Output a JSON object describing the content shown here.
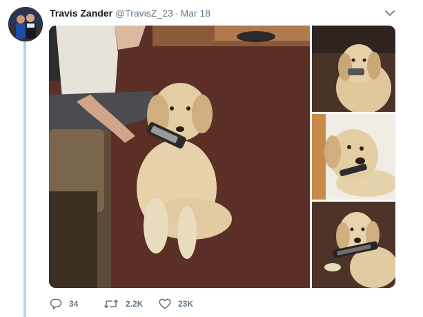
{
  "tweet": {
    "author_name": "Travis Zander",
    "handle": "@TravisZ_23",
    "separator": "·",
    "date": "Mar 18"
  },
  "media": {
    "photos": [
      "golden-retriever-sitting-with-remote",
      "golden-retriever-holding-remote-closeup",
      "golden-retriever-lying-with-remote",
      "golden-retriever-carrying-remote"
    ]
  },
  "actions": {
    "reply_count": "34",
    "retweet_count": "2.2K",
    "like_count": "23K"
  },
  "icons": {
    "reply": "speech-bubble-icon",
    "retweet": "retweet-arrows-icon",
    "like": "heart-outline-icon",
    "more": "chevron-down-icon"
  },
  "colors": {
    "thread_line": "#a9d8f5",
    "text_secondary": "#657786",
    "text_primary": "#14171a"
  }
}
